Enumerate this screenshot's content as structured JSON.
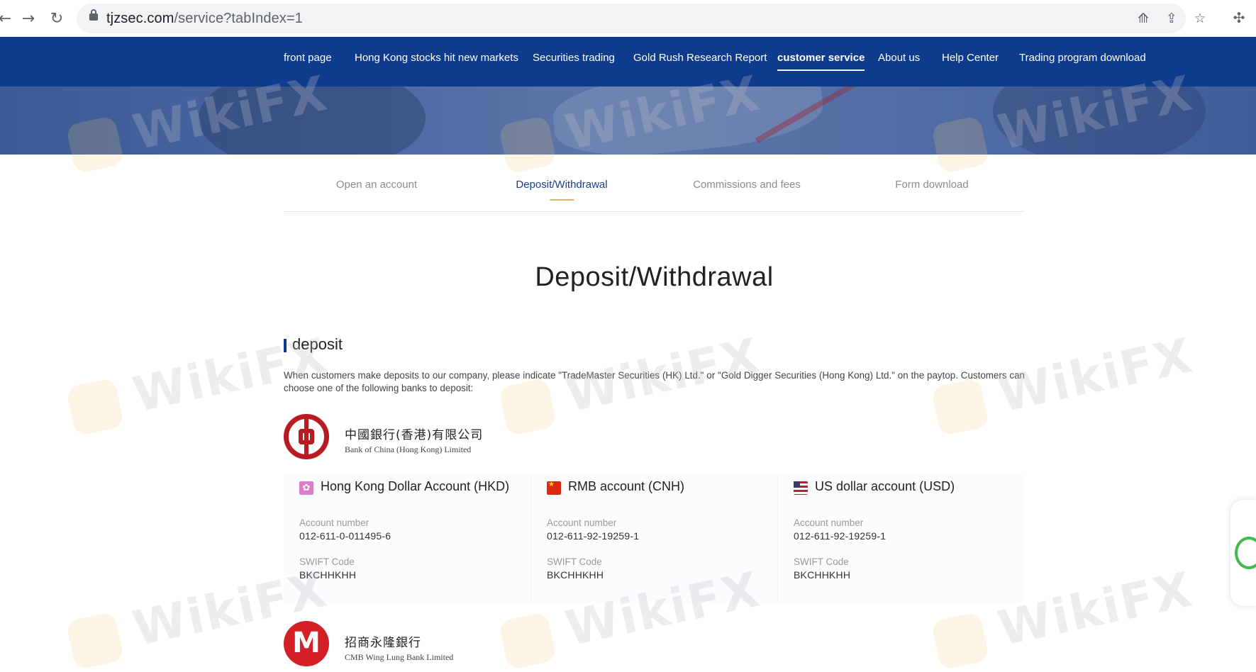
{
  "browser": {
    "url_host": "tjzsec.com",
    "url_path": "/service?tabIndex=1",
    "back_icon": "back-arrow-icon",
    "forward_icon": "forward-arrow-icon",
    "reload_icon": "reload-icon"
  },
  "nav": {
    "items": [
      {
        "label": "front page"
      },
      {
        "label": "Hong Kong stocks hit new markets"
      },
      {
        "label": "Securities trading"
      },
      {
        "label": "Gold Rush Research Report"
      },
      {
        "label": "customer service",
        "active": true
      },
      {
        "label": "About us"
      },
      {
        "label": "Help Center"
      },
      {
        "label": "Trading program download"
      }
    ]
  },
  "tabs": {
    "items": [
      {
        "label": "Open an account"
      },
      {
        "label": "Deposit/Withdrawal",
        "active": true
      },
      {
        "label": "Commissions and fees"
      },
      {
        "label": "Form download"
      }
    ]
  },
  "page_title": "Deposit/Withdrawal",
  "section": {
    "title": "deposit",
    "description": "When customers make deposits to our company, please indicate \"TradeMaster Securities (HK) Ltd.\" or \"Gold Digger Securities (Hong Kong) Ltd.\" on the paytop. Customers can choose one of the following banks to deposit:"
  },
  "banks": [
    {
      "name_cn": "中國銀行(香港)有限公司",
      "name_en": "Bank of China (Hong Kong) Limited",
      "accounts": [
        {
          "name": "Hong Kong Dollar Account (HKD)",
          "flag": "hk-flag-icon",
          "account_label": "Account number",
          "account_number": "012-611-0-011495-6",
          "swift_label": "SWIFT Code",
          "swift_code": "BKCHHKHH"
        },
        {
          "name": "RMB account (CNH)",
          "flag": "cn-flag-icon",
          "account_label": "Account number",
          "account_number": "012-611-92-19259-1",
          "swift_label": "SWIFT Code",
          "swift_code": "BKCHHKHH"
        },
        {
          "name": "US dollar account (USD)",
          "flag": "us-flag-icon",
          "account_label": "Account number",
          "account_number": "012-611-92-19259-1",
          "swift_label": "SWIFT Code",
          "swift_code": "BKCHHKHH"
        }
      ]
    },
    {
      "name_cn": "招商永隆銀行",
      "name_en": "CMB Wing Lung Bank Limited",
      "accounts": []
    }
  ],
  "watermark_text": "WikiFX",
  "colors": {
    "nav_bg": "#0f3b8c",
    "active_tab": "#1c3f7f",
    "tab_underline": "#e1b36b",
    "boc_red": "#b81c22",
    "cmb_red": "#d31f26"
  }
}
